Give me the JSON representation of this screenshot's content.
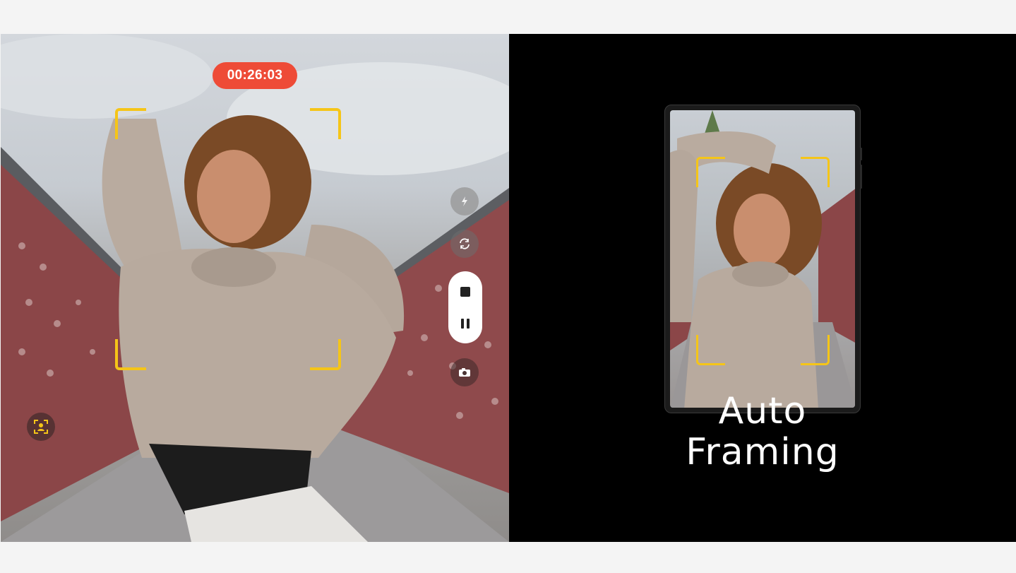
{
  "camera": {
    "timer": "00:26:03",
    "controls": {
      "flash_icon": "flash-off-icon",
      "switch_icon": "switch-camera-icon",
      "stop_icon": "stop-icon",
      "pause_icon": "pause-icon",
      "snapshot_icon": "camera-capture-icon",
      "auto_framing_icon": "auto-framing-icon"
    }
  },
  "promo": {
    "headline_line1": "Auto",
    "headline_line2": "Framing"
  },
  "colors": {
    "timer_bg": "#ee4b37",
    "frame_accent": "#f5c518"
  }
}
